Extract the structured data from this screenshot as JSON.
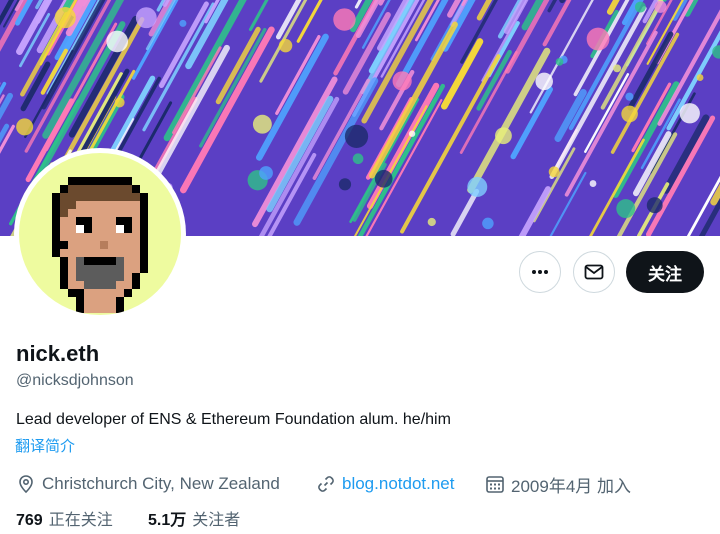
{
  "profile": {
    "display_name": "nick.eth",
    "handle": "@nicksdjohnson",
    "bio": "Lead developer of ENS & Ethereum Foundation alum. he/him",
    "translate_label": "翻译简介",
    "location": "Christchurch City, New Zealand",
    "website": "blog.notdot.net",
    "joined": "2009年4月 加入"
  },
  "actions": {
    "more_icon": "more-dots-icon",
    "message_icon": "envelope-icon",
    "follow_label": "关注"
  },
  "stats": {
    "following_count": "769",
    "following_label": "正在关注",
    "followers_count": "5.1万",
    "followers_label": "关注者"
  },
  "icons": {
    "location": "map-pin-icon",
    "website": "link-icon",
    "joined": "calendar-icon"
  },
  "colors": {
    "banner_base": "#5b3fc4",
    "avatar_background": "#eefb9f",
    "link": "#1d9bf0",
    "follow_button": "#0f1419",
    "secondary_text": "#536471"
  }
}
